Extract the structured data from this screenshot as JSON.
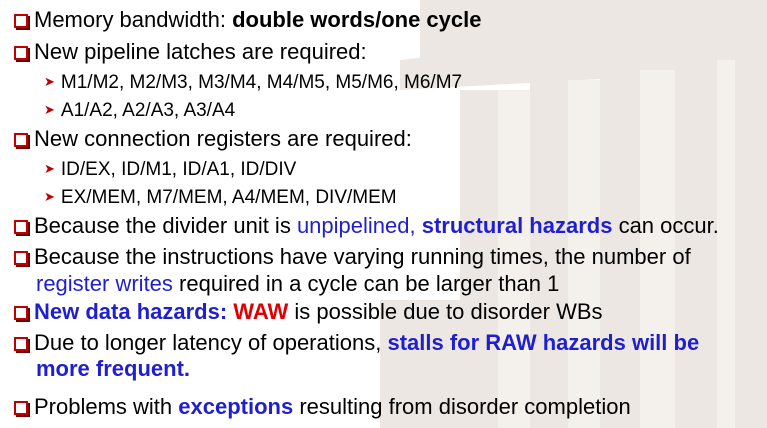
{
  "bullets": {
    "b1": {
      "part1": "Memory bandwidth:  ",
      "part2": "double words/one cycle"
    },
    "b2": {
      "text": "New pipeline latches are required:"
    },
    "b2s1": {
      "text": "M1/M2, M2/M3, M3/M4, M4/M5, M5/M6, M6/M7"
    },
    "b2s2": {
      "text": "A1/A2, A2/A3, A3/A4"
    },
    "b3": {
      "text": "New connection registers are required:"
    },
    "b3s1": {
      "text": "ID/EX, ID/M1, ID/A1, ID/DIV"
    },
    "b3s2": {
      "text": "EX/MEM, M7/MEM, A4/MEM, DIV/MEM"
    },
    "b4": {
      "p1": "Because the divider unit is ",
      "p2": "unpipelined, ",
      "p3": "structural hazards",
      "p4": " can occur."
    },
    "b5": {
      "line1": "Because the instructions have varying running times, the number of",
      "p1": "register writes",
      "p2": " required in a cycle can be larger than 1"
    },
    "b6": {
      "p1": "New data hazards: ",
      "p2": "WAW",
      "p3": " is possible due to disorder WBs"
    },
    "b7": {
      "p1": "Due to longer latency of operations, ",
      "p2": "stalls for RAW hazards will be",
      "p3": "more frequent."
    },
    "b8": {
      "p1": "Problems with ",
      "p2": "exceptions",
      "p3": " resulting from disorder completion"
    }
  },
  "colors": {
    "bullet_box": "#c00000",
    "emphasis_blue": "#1f1fd0",
    "emphasis_red": "#e00000"
  }
}
